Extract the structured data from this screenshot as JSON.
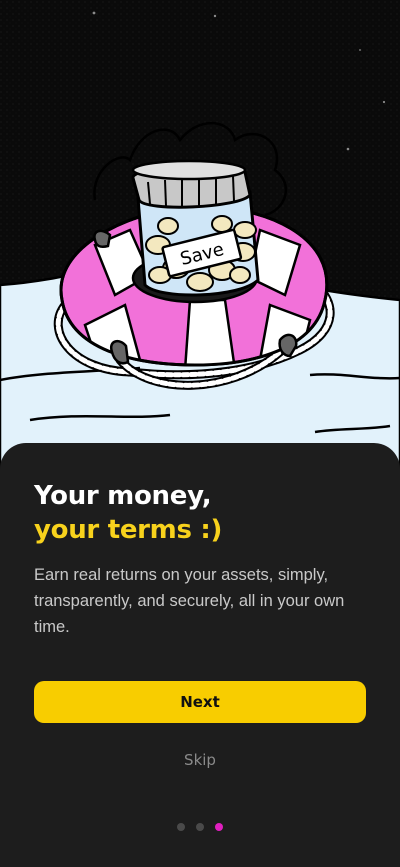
{
  "onboarding": {
    "illustration": {
      "jar_label": "Save",
      "description_icon": "life-ring-money-jar-illustration"
    },
    "title_line1": "Your money,",
    "title_line2": "your terms :)",
    "description": "Earn real returns on your assets, simply, transparently, and securely, all in your own time.",
    "next_label": "Next",
    "skip_label": "Skip",
    "pagination": {
      "total": 3,
      "active_index": 2
    }
  },
  "colors": {
    "background": "#000000",
    "sheet": "#1d1d1d",
    "accent_yellow": "#f8cd00",
    "accent_pink": "#e01fbf",
    "title_white": "#ffffff",
    "title_yellow": "#f8d21c"
  }
}
